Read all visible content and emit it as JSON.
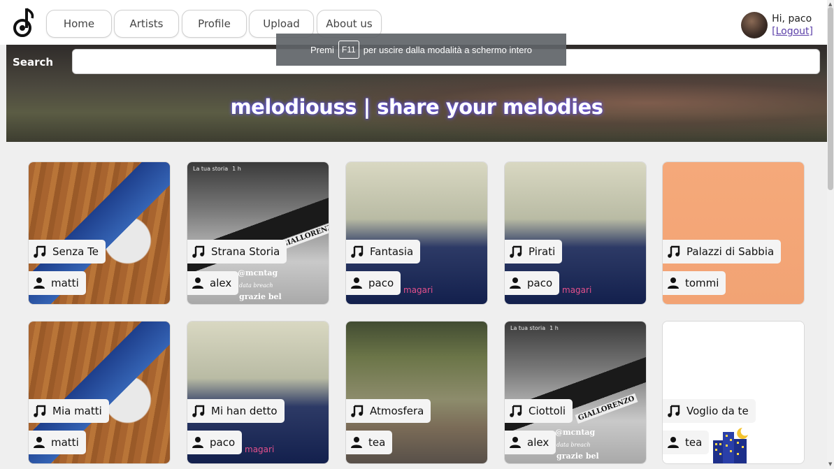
{
  "nav": {
    "items": [
      "Home",
      "Artists",
      "Profile",
      "Upload",
      "About us"
    ]
  },
  "user": {
    "greeting": "Hi, paco",
    "logout": "[Logout]"
  },
  "toast": {
    "before": "Premi",
    "key": "F11",
    "after": "per uscire dalla modalità a schermo intero"
  },
  "search": {
    "label": "Search",
    "value": ""
  },
  "hero": {
    "title": "melodiouss | share your melodies"
  },
  "songs": [
    {
      "title": "Senza Te",
      "artist": "matti",
      "art": "guitar"
    },
    {
      "title": "Strana Storia",
      "artist": "alex",
      "art": "story"
    },
    {
      "title": "Fantasia",
      "artist": "paco",
      "art": "fantasia"
    },
    {
      "title": "Pirati",
      "artist": "paco",
      "art": "fantasia"
    },
    {
      "title": "Palazzi di Sabbia",
      "artist": "tommi",
      "art": "peach"
    },
    {
      "title": "Mia matti",
      "artist": "matti",
      "art": "guitar"
    },
    {
      "title": "Mi han detto",
      "artist": "paco",
      "art": "fantasia"
    },
    {
      "title": "Atmosfera",
      "artist": "tea",
      "art": "landscape"
    },
    {
      "title": "Ciottoli",
      "artist": "alex",
      "art": "story"
    },
    {
      "title": "Voglio da te",
      "artist": "tea",
      "art": "white"
    }
  ],
  "art_text": {
    "story_header": "La tua storia",
    "story_time": "1 h",
    "story_tag": "@mcntag",
    "story_line": "data breach",
    "story_caption": "grazie bel",
    "story_banner": "GIALLORENZO",
    "magari": "magari"
  },
  "colors": {
    "logout_link": "#5b3fa8",
    "hero_glow": "#6a5cff",
    "toast_bg": "#5f6468"
  }
}
